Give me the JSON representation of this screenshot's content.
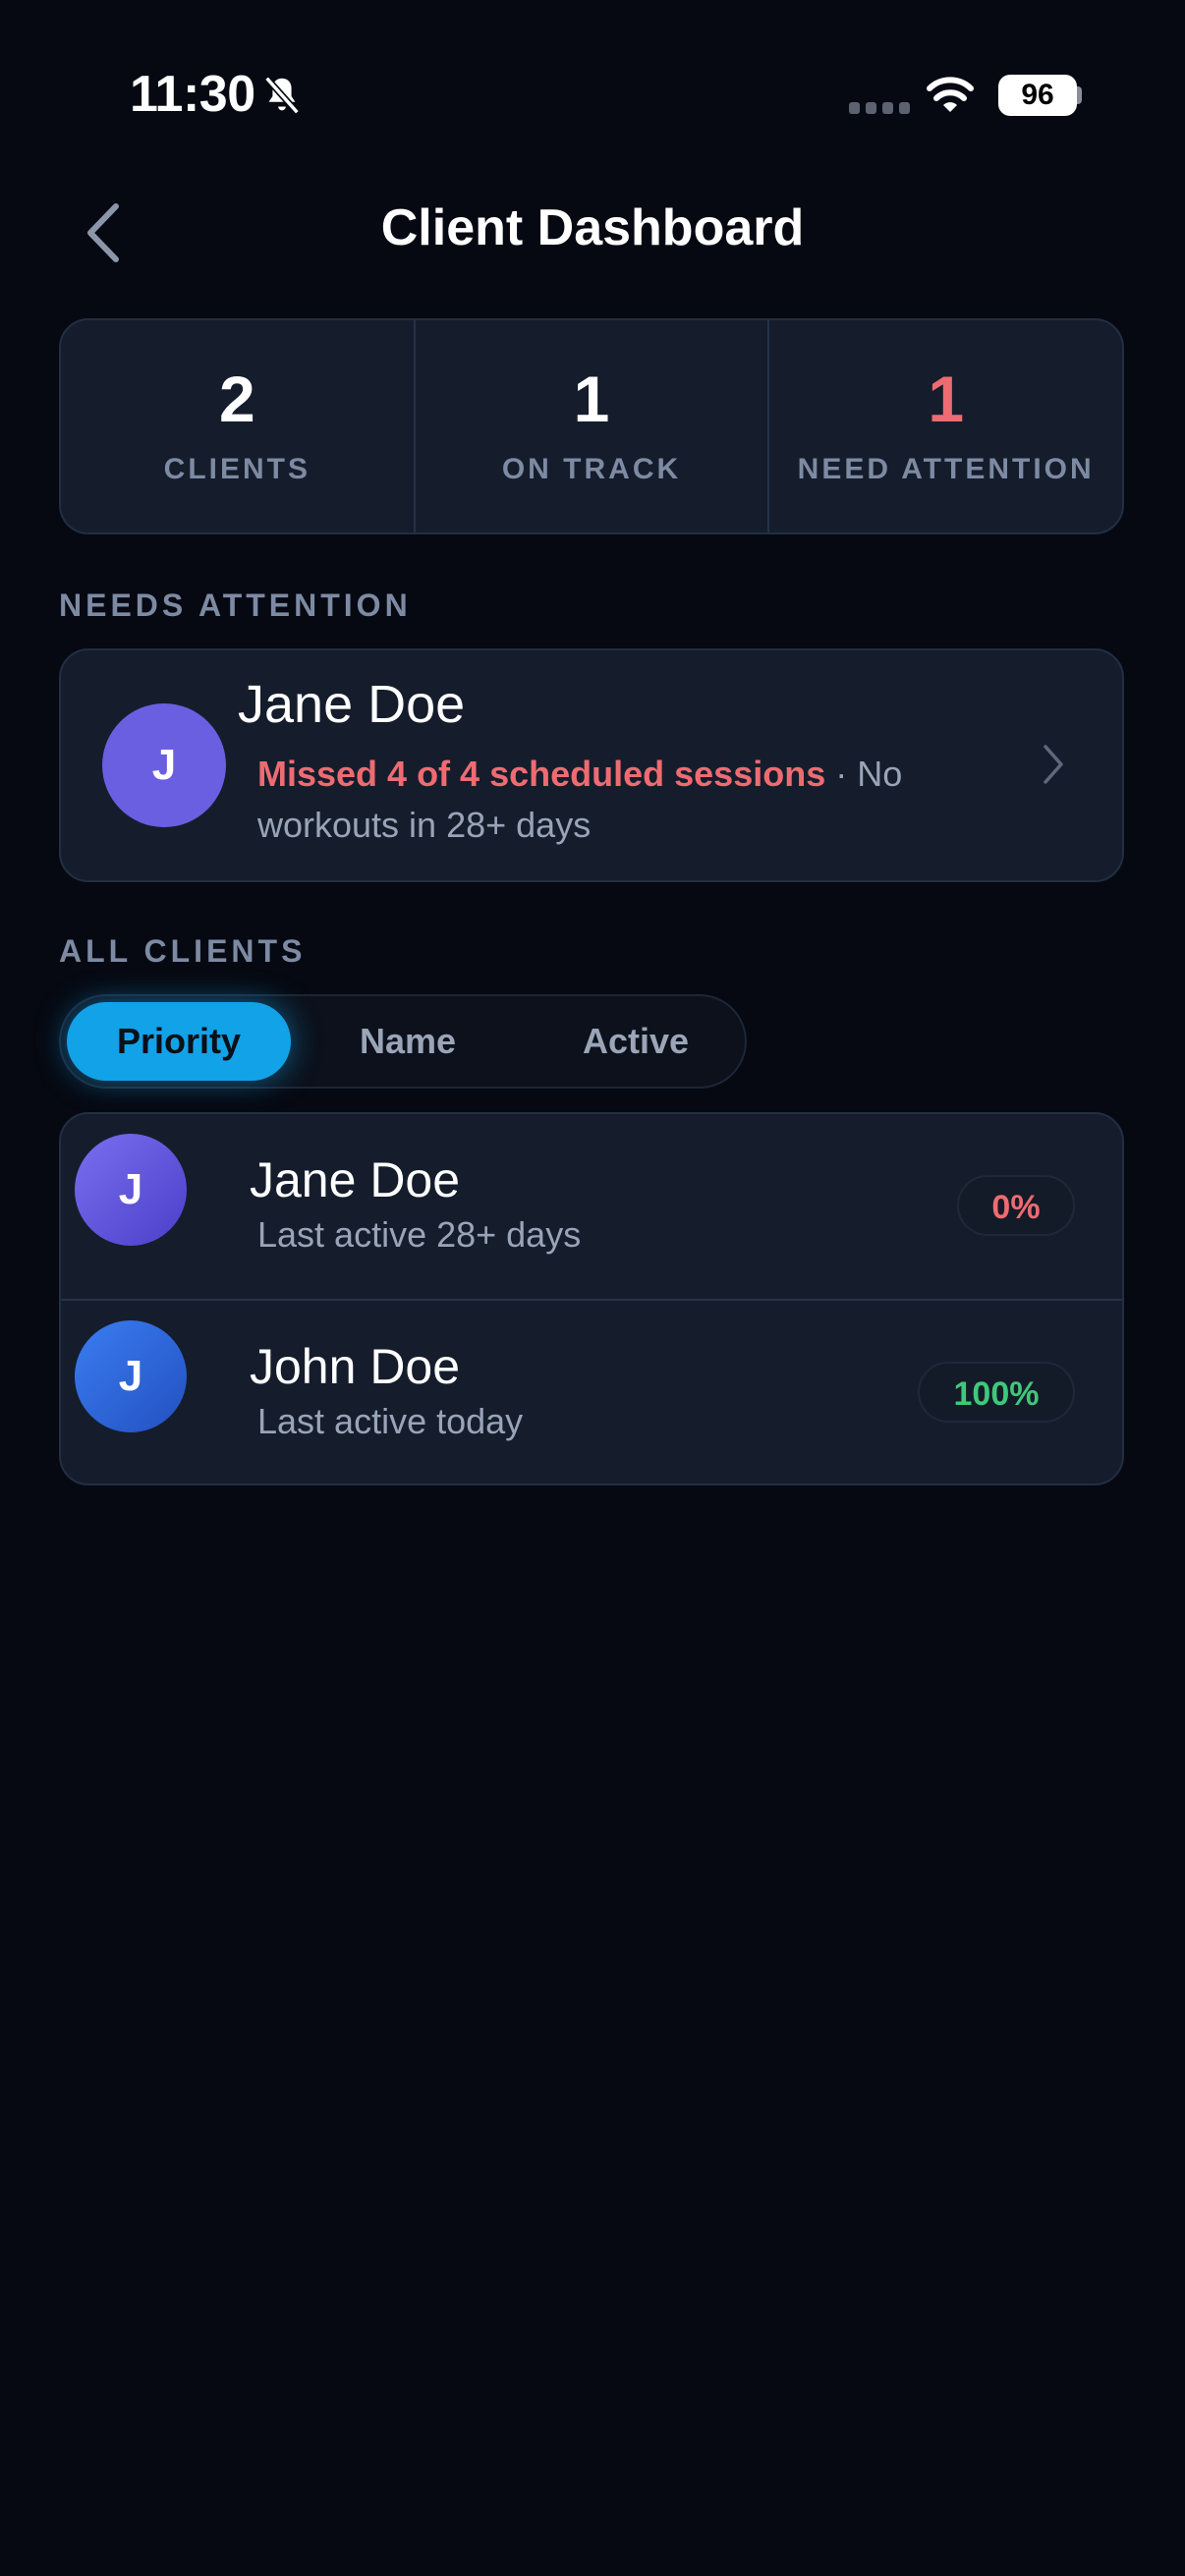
{
  "status_bar": {
    "time": "11:30",
    "battery": "96"
  },
  "header": {
    "title": "Client Dashboard"
  },
  "stats": [
    {
      "value": "2",
      "label": "CLIENTS",
      "color": "#ffffff"
    },
    {
      "value": "1",
      "label": "ON TRACK",
      "color": "#ffffff"
    },
    {
      "value": "1",
      "label": "NEED ATTENTION",
      "color": "#ee6b72"
    }
  ],
  "needs_attention": {
    "label": "NEEDS ATTENTION",
    "client": {
      "initial": "J",
      "name": "Jane Doe",
      "missed": "Missed 4 of 4 scheduled sessions",
      "detail": " · No workouts in 28+ days"
    }
  },
  "all_clients": {
    "label": "ALL CLIENTS",
    "sort_options": [
      "Priority",
      "Name",
      "Active"
    ],
    "selected_sort": "Priority",
    "clients": [
      {
        "initial": "J",
        "name": "Jane Doe",
        "last_active": "Last active 28+ days",
        "progress": "0%",
        "progress_color": "#ee6b72"
      },
      {
        "initial": "J",
        "name": "John Doe",
        "last_active": "Last active today",
        "progress": "100%",
        "progress_color": "#3ec97a"
      }
    ]
  }
}
